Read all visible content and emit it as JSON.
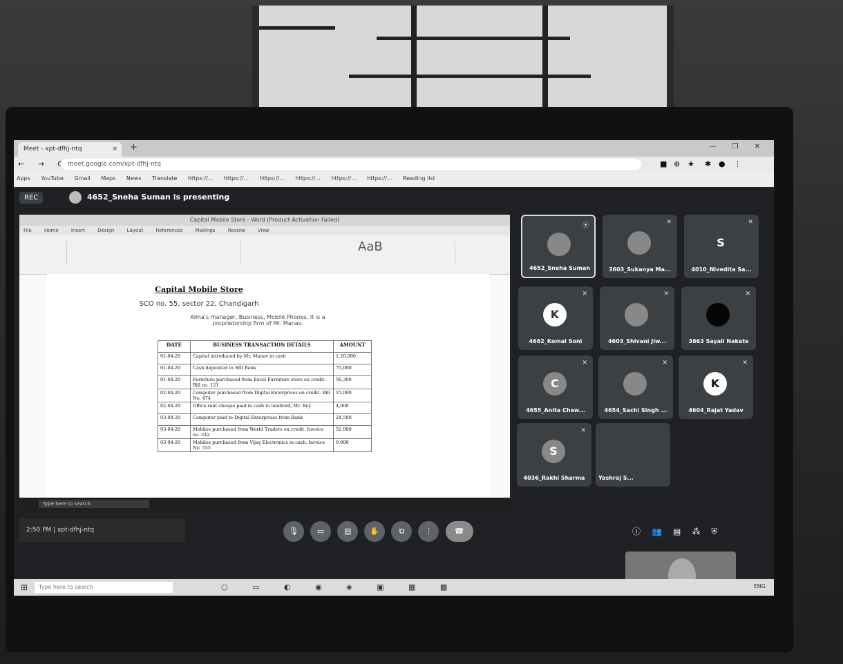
{
  "browser": {
    "tab_title": "Meet - xpt-dfhj-ntq",
    "tab_close": "×",
    "new_tab": "+",
    "window_controls": "— ❐ ✕",
    "nav": "← → C",
    "url": "meet.google.com/xpt-dfhj-ntq",
    "bookmarks": [
      "Apps",
      "YouTube",
      "Gmail",
      "Maps",
      "News",
      "Translate",
      "https://...",
      "https://...",
      "https://...",
      "https://...",
      "https://...",
      "https://...",
      "Reading list"
    ]
  },
  "meet": {
    "rec_label": "REC",
    "presenting_text": "4652_Sneha Suman is presenting",
    "clock": "2:50 PM",
    "meeting_code": "xpt-dfhj-ntq",
    "participants": [
      {
        "name": "4652_Sneha Suman",
        "initial": ""
      },
      {
        "name": "3603_Sukanya Ma...",
        "initial": ""
      },
      {
        "name": "4010_Nivedita Sa...",
        "initial": "S"
      },
      {
        "name": "4662_Komal Soni",
        "initial": "K"
      },
      {
        "name": "4603_Shivani Jiw...",
        "initial": ""
      },
      {
        "name": "3663 Sayali Nakate",
        "initial": ""
      },
      {
        "name": "4655_Anita Chaw...",
        "initial": "C"
      },
      {
        "name": "4654_Sachi Singh ...",
        "initial": ""
      },
      {
        "name": "4604_Rajat Yadav",
        "initial": "K"
      },
      {
        "name": "4036_Rakhi Sharma",
        "initial": "S"
      },
      {
        "name": "Yashraj S...",
        "initial": ""
      }
    ],
    "controls": [
      "mic",
      "cam",
      "cc",
      "hand",
      "present",
      "more",
      "end"
    ]
  },
  "document": {
    "window_title": "Capital Mobile Store - Word (Product Activation Failed)",
    "menu": [
      "File",
      "Home",
      "Insert",
      "Design",
      "Layout",
      "References",
      "Mailings",
      "Review",
      "View"
    ],
    "styles_sample": "AaB",
    "title": "Capital Mobile Store",
    "address": "SCO no. 55, sector 22, Chandigarh",
    "note": "Alma's manager, Business, Mobile Phones, it is a proprietorship firm of Mr. Manav.",
    "table": {
      "headers": [
        "DATE",
        "BUSINESS TRANSACTION DETAILS",
        "AMOUNT"
      ],
      "rows": [
        [
          "01-04-20",
          "Capital introduced by Mr. Manav in cash",
          "1,20,000"
        ],
        [
          "01-04-20",
          "Cash deposited in SBI Bank",
          "75,000"
        ],
        [
          "01-04-20",
          "Furniture purchased from Excel Furniture store on credit. Bill no. 121",
          "56,300"
        ],
        [
          "02-04-20",
          "Computer purchased from Digital Enterprises on credit. Bill No. 474",
          "15,000"
        ],
        [
          "02-04-20",
          "Office rent cheque paid in cash to landlord, Mr. Roy",
          "4,000"
        ],
        [
          "03-04-20",
          "Computer paid to Digital Enterprises from Bank",
          "24,500"
        ],
        [
          "03-04-20",
          "Mobiles purchased from World Traders on credit. Invoice no. 242",
          "52,000"
        ],
        [
          "03-04-20",
          "Mobiles purchased from Vijay Electronics in cash. Invoice No. 555",
          "9,000"
        ]
      ]
    },
    "inner_search": "Type here to search"
  },
  "taskbar": {
    "search": "Type here to search",
    "tray": "ENG"
  }
}
